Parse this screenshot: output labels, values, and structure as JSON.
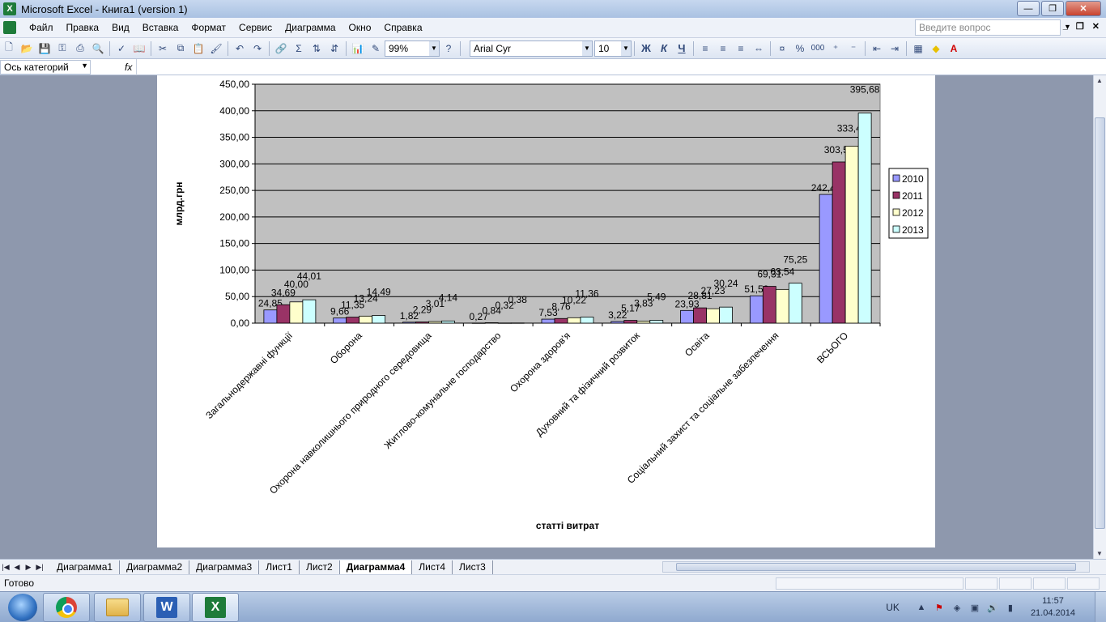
{
  "window": {
    "title": "Microsoft Excel - Книга1 (version 1)"
  },
  "menu": {
    "items": [
      "Файл",
      "Правка",
      "Вид",
      "Вставка",
      "Формат",
      "Сервис",
      "Диаграмма",
      "Окно",
      "Справка"
    ],
    "ask_placeholder": "Введите вопрос"
  },
  "toolbar": {
    "zoom": "99%",
    "font": "Arial Cyr",
    "size": "10",
    "bold": "Ж",
    "italic": "К",
    "underline": "Ч",
    "percent": "%",
    "thousands": "000"
  },
  "formula_bar": {
    "name_box": "Ось категорий",
    "fx": "fx"
  },
  "chart_data": {
    "type": "bar",
    "categories": [
      "Загальнодержавні функції",
      "Оборона",
      "Охорона навколишнього природного середовища",
      "Житлово-комунальне господарство",
      "Охорона здоров'я",
      "Духовний та фізичний розвиток",
      "Освіта",
      "Соціальний захист та соціальне забезпечення",
      "ВСЬОГО"
    ],
    "series": [
      {
        "name": "2010",
        "color": "#9999ff",
        "values": [
          24.85,
          9.66,
          1.82,
          0.27,
          7.53,
          3.22,
          23.93,
          51.52,
          242.44
        ]
      },
      {
        "name": "2011",
        "color": "#993366",
        "values": [
          34.69,
          11.35,
          2.29,
          0.84,
          8.76,
          5.17,
          28.81,
          69.31,
          303.59
        ]
      },
      {
        "name": "2012",
        "color": "#ffffcc",
        "values": [
          40.0,
          13.24,
          3.01,
          0.32,
          10.22,
          3.83,
          27.23,
          63.54,
          333.46
        ]
      },
      {
        "name": "2013",
        "color": "#ccffff",
        "values": [
          44.01,
          14.49,
          4.14,
          0.38,
          11.36,
          5.49,
          30.24,
          75.25,
          395.68
        ]
      }
    ],
    "data_labels": [
      [
        "24,85",
        "9,66",
        "1,82",
        "0,27",
        "7,53",
        "3,22",
        "23,93",
        "51,52",
        "242,44"
      ],
      [
        "34,69",
        "11,35",
        "2,29",
        "0,84",
        "8,76",
        "5,17",
        "28,81",
        "69,31",
        "303,59"
      ],
      [
        "40,00",
        "13,24",
        "3,01",
        "0,32",
        "10,22",
        "3,83",
        "27,23",
        "63,54",
        "333,46"
      ],
      [
        "44,01",
        "14,49",
        "4,14",
        "0,38",
        "11,36",
        "5,49",
        "30,24",
        "75,25",
        "395,68"
      ]
    ],
    "y_ticks": [
      "0,00",
      "50,00",
      "100,00",
      "150,00",
      "200,00",
      "250,00",
      "300,00",
      "350,00",
      "400,00",
      "450,00"
    ],
    "ylim": [
      0,
      450
    ],
    "xlabel": "статті витрат",
    "ylabel": "млрд.грн",
    "plot_background": "#c0c0c0",
    "grid": true,
    "legend_position": "right"
  },
  "sheet_tabs": [
    "Диаграмма1",
    "Диаграмма2",
    "Диаграмма3",
    "Лист1",
    "Лист2",
    "Диаграмма4",
    "Лист4",
    "Лист3"
  ],
  "active_sheet": "Диаграмма4",
  "status": {
    "text": "Готово"
  },
  "taskbar": {
    "lang": "UK",
    "time": "11:57",
    "date": "21.04.2014",
    "apps": [
      "chrome-icon",
      "folder-icon",
      "word-icon",
      "excel-icon"
    ]
  }
}
